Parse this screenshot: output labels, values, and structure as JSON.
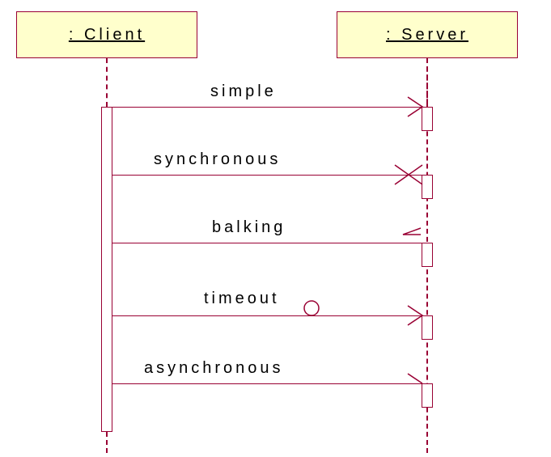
{
  "participants": {
    "client": ": Client",
    "server": ": Server"
  },
  "messages": {
    "m1": "simple",
    "m2": "synchronous",
    "m3": "balking",
    "m4": "timeout",
    "m5": "asynchronous"
  }
}
